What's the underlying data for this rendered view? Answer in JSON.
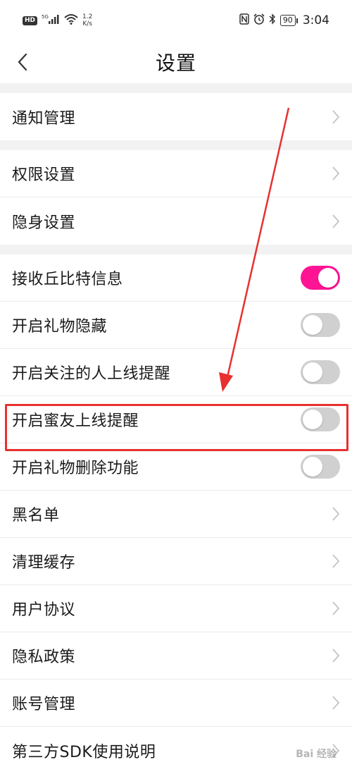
{
  "status_bar": {
    "hd": "HD",
    "signal": "5G",
    "net_speed_value": "1.2",
    "net_speed_unit": "K/s",
    "battery": "90",
    "time": "3:04"
  },
  "header": {
    "title": "设置"
  },
  "sections": [
    {
      "items": [
        {
          "label": "通知管理",
          "type": "chevron"
        }
      ]
    },
    {
      "items": [
        {
          "label": "权限设置",
          "type": "chevron"
        },
        {
          "label": "隐身设置",
          "type": "chevron"
        }
      ]
    },
    {
      "items": [
        {
          "label": "接收丘比特信息",
          "type": "toggle",
          "on": true
        },
        {
          "label": "开启礼物隐藏",
          "type": "toggle",
          "on": false
        },
        {
          "label": "开启关注的人上线提醒",
          "type": "toggle",
          "on": false
        },
        {
          "label": "开启蜜友上线提醒",
          "type": "toggle",
          "on": false
        },
        {
          "label": "开启礼物删除功能",
          "type": "toggle",
          "on": false
        },
        {
          "label": "黑名单",
          "type": "chevron"
        },
        {
          "label": "清理缓存",
          "type": "chevron"
        },
        {
          "label": "用户协议",
          "type": "chevron"
        },
        {
          "label": "隐私政策",
          "type": "chevron"
        },
        {
          "label": "账号管理",
          "type": "chevron"
        },
        {
          "label": "第三方SDK使用说明",
          "type": "chevron"
        }
      ]
    }
  ],
  "colors": {
    "toggle_on": "#ff1494",
    "toggle_off": "#d0d0d0",
    "highlight": "#e8302f"
  },
  "watermark": "Bai 经验"
}
